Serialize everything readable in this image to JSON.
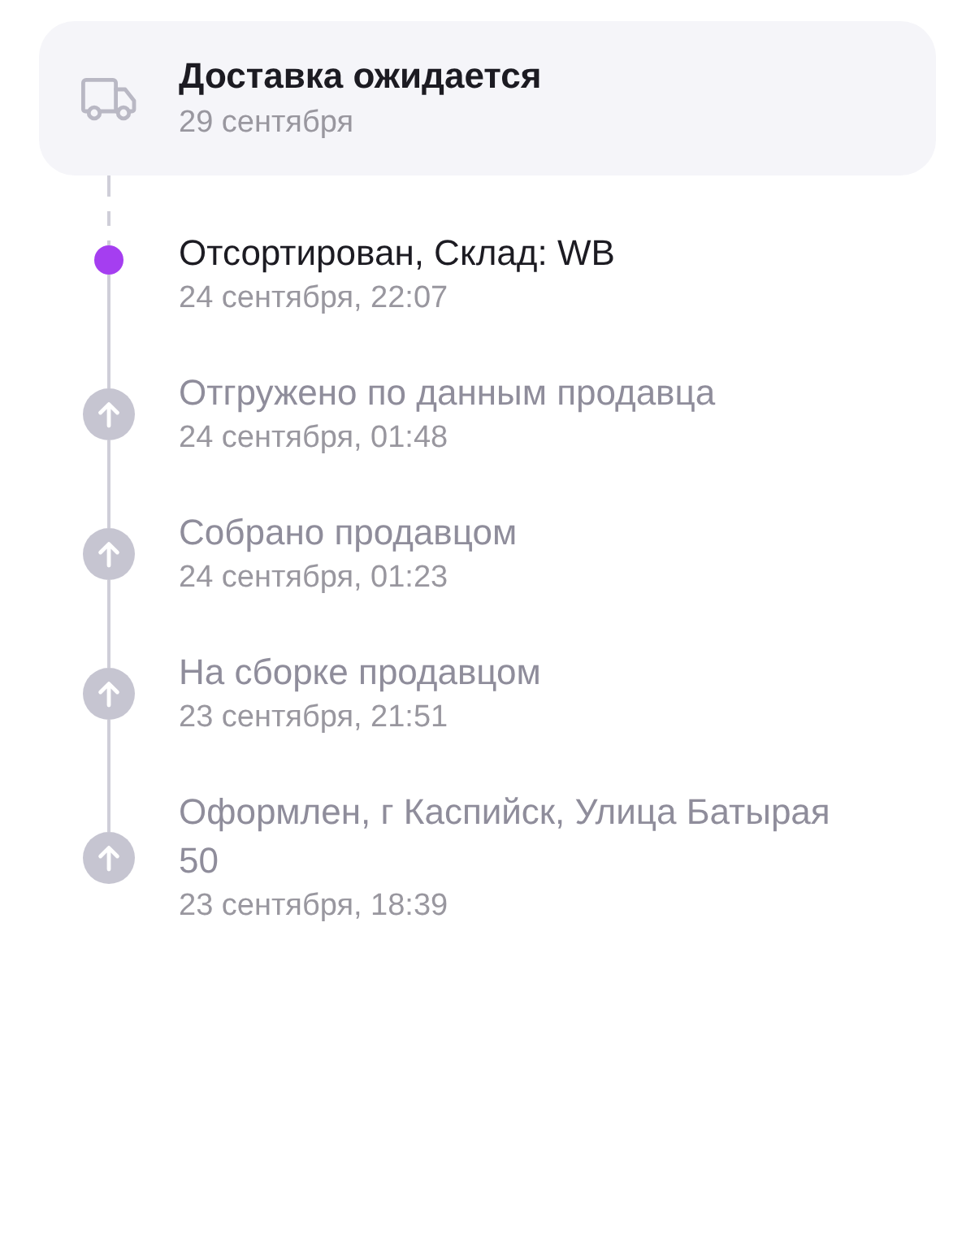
{
  "delivery": {
    "title": "Доставка ожидается",
    "date": "29 сентября"
  },
  "events": [
    {
      "title": "Отсортирован, Склад: WB",
      "time": "24 сентября, 22:07",
      "current": true
    },
    {
      "title": "Отгружено по данным продавца",
      "time": "24 сентября, 01:48",
      "current": false
    },
    {
      "title": "Собрано продавцом",
      "time": "24 сентября, 01:23",
      "current": false
    },
    {
      "title": "На сборке продавцом",
      "time": "23 сентября, 21:51",
      "current": false
    },
    {
      "title": "Оформлен, г Каспийск, Улица Батырая 50",
      "time": "23 сентября, 18:39",
      "current": false
    }
  ]
}
